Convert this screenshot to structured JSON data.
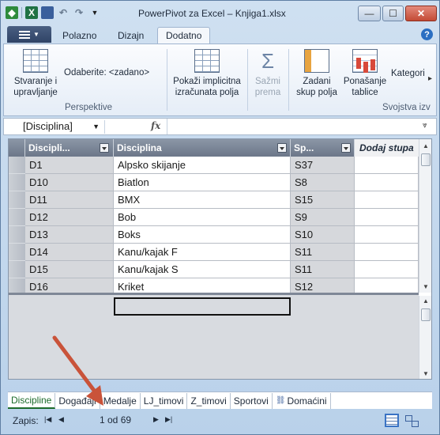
{
  "window": {
    "title": "PowerPivot za Excel – Knjiga1.xlsx",
    "controls": {
      "minimize": "—",
      "maximize": "☐",
      "close": "✕"
    }
  },
  "ribbon_tabs": [
    {
      "label": "Polazno"
    },
    {
      "label": "Dizajn"
    },
    {
      "label": "Dodatno"
    }
  ],
  "ribbon": {
    "create_manage": "Stvaranje i upravljanje",
    "select_label": "Odaberite: <zadano>",
    "perspectives_group": "Perspektive",
    "show_implicit": "Pokaži implicitna izračunata polja",
    "summarize": "Sažmi prema",
    "default_fields": "Zadani skup polja",
    "table_behavior": "Ponašanje tablice",
    "category": "Kategori",
    "report_props_group": "Svojstva izv"
  },
  "formula_bar": {
    "name_box": "[Disciplina]",
    "fx": "fx"
  },
  "grid": {
    "columns": [
      {
        "label": "Discipli..."
      },
      {
        "label": "Disciplina"
      },
      {
        "label": "Sp..."
      },
      {
        "label": "Dodaj stupa"
      }
    ],
    "rows": [
      [
        "D1",
        "Alpsko skijanje",
        "S37"
      ],
      [
        "D10",
        "Biatlon",
        "S8"
      ],
      [
        "D11",
        "BMX",
        "S15"
      ],
      [
        "D12",
        "Bob",
        "S9"
      ],
      [
        "D13",
        "Boks",
        "S10"
      ],
      [
        "D14",
        "Kanu/kajak F",
        "S11"
      ],
      [
        "D15",
        "Kanu/kajak S",
        "S11"
      ],
      [
        "D16",
        "Kriket",
        "S12"
      ]
    ]
  },
  "sheet_tabs": [
    {
      "label": "Discipline"
    },
    {
      "label": "Događaji"
    },
    {
      "label": "Medalje"
    },
    {
      "label": "LJ_timovi"
    },
    {
      "label": "Z_timovi"
    },
    {
      "label": "Sportovi"
    },
    {
      "label": "Domaćini"
    }
  ],
  "status_bar": {
    "record_label": "Zapis:",
    "record_count": "1 od 69"
  },
  "colors": {
    "accent_red_arrow": "#c9533a",
    "header_bg": "#7b8699",
    "active_sheet": "#1c6b2b"
  }
}
